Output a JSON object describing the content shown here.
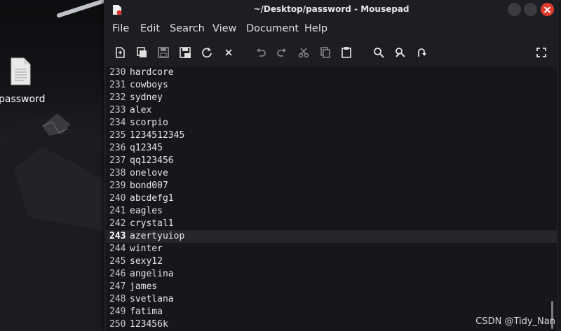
{
  "desktop": {
    "icon_label": "password"
  },
  "window": {
    "title": "~/Desktop/password - Mousepad",
    "menu": [
      "File",
      "Edit",
      "Search",
      "View",
      "Document",
      "Help"
    ],
    "toolbar_icons": [
      "new-document-icon",
      "new-window-icon",
      "save-icon",
      "save-as-icon",
      "reload-icon",
      "close-document-icon",
      "undo-icon",
      "redo-icon",
      "cut-icon",
      "copy-icon",
      "paste-icon",
      "search-icon",
      "find-replace-icon",
      "goto-icon",
      "fullscreen-icon"
    ],
    "current_line": 243,
    "lines": [
      {
        "n": "230",
        "t": "hardcore"
      },
      {
        "n": "231",
        "t": "cowboys"
      },
      {
        "n": "232",
        "t": "sydney"
      },
      {
        "n": "233",
        "t": "alex"
      },
      {
        "n": "234",
        "t": "scorpio"
      },
      {
        "n": "235",
        "t": "1234512345"
      },
      {
        "n": "236",
        "t": "q12345"
      },
      {
        "n": "237",
        "t": "qq123456"
      },
      {
        "n": "238",
        "t": "onelove"
      },
      {
        "n": "239",
        "t": "bond007"
      },
      {
        "n": "240",
        "t": "abcdefg1"
      },
      {
        "n": "241",
        "t": "eagles"
      },
      {
        "n": "242",
        "t": "crystal1"
      },
      {
        "n": "243",
        "t": "azertyuiop"
      },
      {
        "n": "244",
        "t": "winter"
      },
      {
        "n": "245",
        "t": "sexy12"
      },
      {
        "n": "246",
        "t": "angelina"
      },
      {
        "n": "247",
        "t": "james"
      },
      {
        "n": "248",
        "t": "svetlana"
      },
      {
        "n": "249",
        "t": "fatima"
      },
      {
        "n": "250",
        "t": "123456k"
      }
    ]
  },
  "watermark": "CSDN @Tidy_Nan"
}
